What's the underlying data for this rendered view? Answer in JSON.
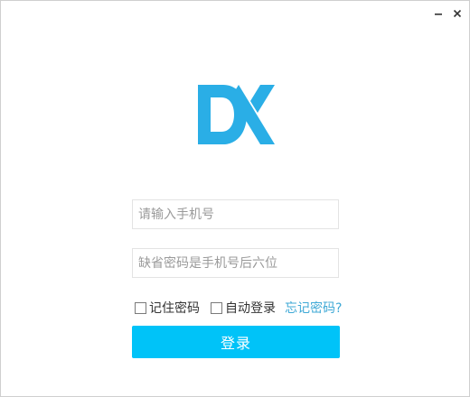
{
  "window": {
    "minimize_icon": "minimize-icon",
    "close_icon": "close-icon"
  },
  "logo": {
    "icon": "dx-logo",
    "color": "#2aaee6"
  },
  "login_form": {
    "phone_placeholder": "请输入手机号",
    "phone_value": "",
    "password_placeholder": "缺省密码是手机号后六位",
    "password_value": "",
    "remember_label": "记住密码",
    "remember_checked": false,
    "auto_login_label": "自动登录",
    "auto_login_checked": false,
    "forgot_link": "忘记密码?",
    "login_button": "登录"
  },
  "colors": {
    "button": "#00c3f8",
    "link": "#3fa9d6",
    "logo": "#2aaee6"
  }
}
